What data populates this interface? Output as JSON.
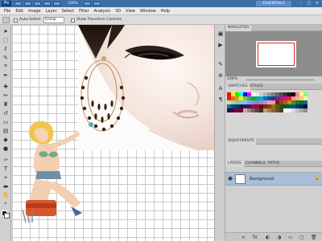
{
  "app": {
    "logo": "Ps",
    "zoom": "100%",
    "workspace": "ESSENTIALS"
  },
  "menu": [
    "File",
    "Edit",
    "Image",
    "Layer",
    "Select",
    "Filter",
    "Analysis",
    "3D",
    "View",
    "Window",
    "Help"
  ],
  "options": {
    "auto_select_label": "Auto-Select:",
    "auto_select_value": "Group",
    "transform_label": "Show Transform Controls"
  },
  "panels": {
    "navigator_tab": "NAVIGATOR",
    "zoom_value": "100%",
    "swatches_tab": "SWATCHES",
    "styles_tab": "STYLES",
    "adjustments_tab": "ADJUSTMENTS",
    "layers_tab": "LAYERS",
    "channels_tab": "CHANNELS",
    "paths_tab": "PATHS",
    "layer_name": "Background"
  },
  "colors": {
    "title_bar": "#3d6ea8",
    "layer_selected": "#a9bed6",
    "navigator_frame": "#e0262d"
  },
  "swatches": [
    "#ff0000",
    "#ffff00",
    "#00ff00",
    "#00ffff",
    "#0000ff",
    "#ff00ff",
    "#ffffff",
    "#e6e6e6",
    "#cccccc",
    "#b3b3b3",
    "#999999",
    "#808080",
    "#666666",
    "#4d4d4d",
    "#333333",
    "#1a1a1a",
    "#000000",
    "#ff8080",
    "#ffff80",
    "#80ff80",
    "#ed1c24",
    "#f26522",
    "#f7941d",
    "#fff200",
    "#8dc63f",
    "#39b54a",
    "#00a651",
    "#00a99d",
    "#00aeef",
    "#0072bc",
    "#0054a6",
    "#2e3192",
    "#662d91",
    "#92278f",
    "#ec008c",
    "#ed145b",
    "#f69679",
    "#f9ad81",
    "#fdc68a",
    "#fff79a",
    "#c4df9b",
    "#a3d39c",
    "#82ca9c",
    "#7accc8",
    "#6dcff6",
    "#7da7d9",
    "#8393ca",
    "#8781bd",
    "#a187be",
    "#bd8cbf",
    "#f49ac1",
    "#f6989d",
    "#9e0b0f",
    "#a0410d",
    "#a36209",
    "#aba000",
    "#598527",
    "#1a7b30",
    "#007236",
    "#00746b",
    "#0076a3",
    "#004b80",
    "#003471",
    "#1b1464",
    "#440e62",
    "#630460",
    "#9e005d",
    "#9e0039",
    "#790000",
    "#7b2e00",
    "#7d4900",
    "#827b00",
    "#406618",
    "#005e20",
    "#005826",
    "#005952",
    "#005b7f",
    "#003663",
    "#002157",
    "#0d004c",
    "#32004b",
    "#4b0049",
    "#7b0046",
    "#7a0026",
    "#c7b299",
    "#998675",
    "#736357",
    "#534741",
    "#37302a",
    "#c69c6d",
    "#a67c52",
    "#8c6239",
    "#754c24",
    "#603913",
    "#ffffff",
    "#f2f2f2",
    "#d9d9d9",
    "#bfbfbf",
    "#a6a6a6",
    "#8c8c8c"
  ]
}
